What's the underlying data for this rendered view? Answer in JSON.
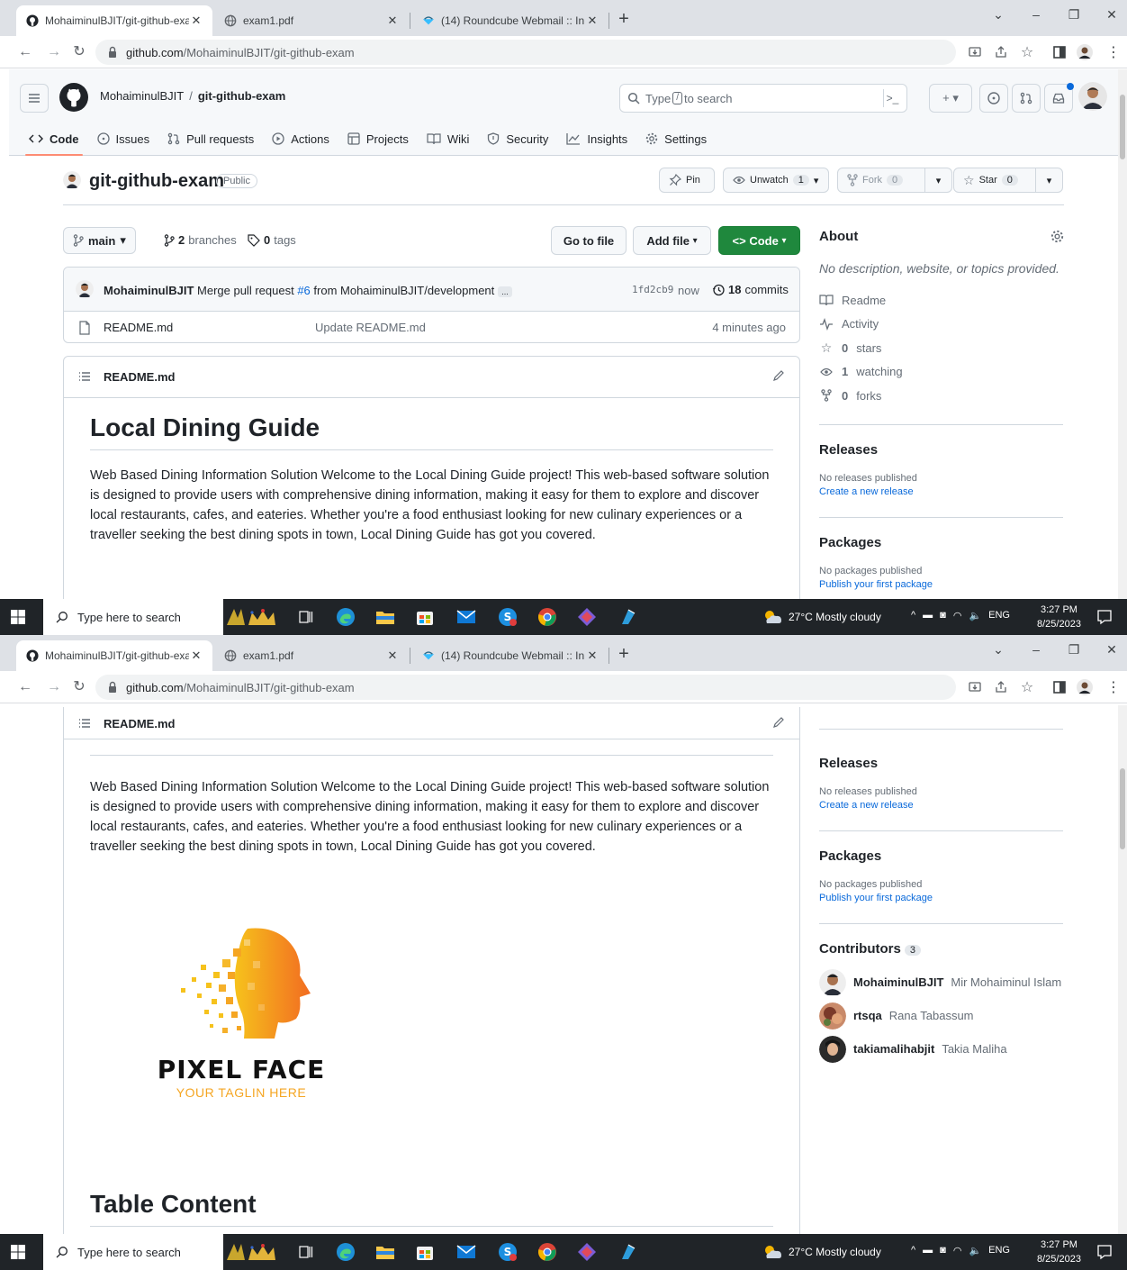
{
  "browser": {
    "tabs": [
      {
        "title": "MohaiminulBJIT/git-github-exam",
        "active": true
      },
      {
        "title": "exam1.pdf",
        "active": false
      },
      {
        "title": "(14) Roundcube Webmail :: Inbox",
        "active": false
      }
    ],
    "url_host": "github.com",
    "url_path": "/MohaiminulBJIT/git-github-exam"
  },
  "header": {
    "owner": "MohaiminulBJIT",
    "separator": "/",
    "repo": "git-github-exam",
    "search_prefix": "Type",
    "search_key": "/",
    "search_suffix": "to search"
  },
  "repo_nav": {
    "items": [
      "Code",
      "Issues",
      "Pull requests",
      "Actions",
      "Projects",
      "Wiki",
      "Security",
      "Insights",
      "Settings"
    ]
  },
  "title_row": {
    "name": "git-github-exam",
    "visibility": "Public",
    "pin": "Pin",
    "unwatch": "Unwatch",
    "unwatch_count": "1",
    "fork": "Fork",
    "fork_count": "0",
    "star": "Star",
    "star_count": "0"
  },
  "branch_row": {
    "branch": "main",
    "branches_count": "2",
    "branches_label": "branches",
    "tags_count": "0",
    "tags_label": "tags",
    "go_to_file": "Go to file",
    "add_file": "Add file",
    "code": "Code"
  },
  "commit": {
    "author": "MohaiminulBJIT",
    "message_pre": "Merge pull request",
    "pr": "#6",
    "message_post": "from MohaiminulBJIT/development",
    "ellipsis": "...",
    "sha": "1fd2cb9",
    "when": "now",
    "commits_count": "18",
    "commits_label": "commits"
  },
  "files": [
    {
      "name": "README.md",
      "message": "Update README.md",
      "age": "4 minutes ago"
    }
  ],
  "readme": {
    "filename": "README.md",
    "h1": "Local Dining Guide",
    "paragraph": "Web Based Dining Information Solution Welcome to the Local Dining Guide project! This web-based software solution is designed to provide users with comprehensive dining information, making it easy for them to explore and discover local restaurants, cafes, and eateries. Whether you're a food enthusiast looking for new culinary experiences or a traveller seeking the best dining spots in town, Local Dining Guide has got you covered.",
    "logo_text": "PIXEL FACE",
    "logo_tagline": "YOUR TAGLIN HERE",
    "h2": "Table Content"
  },
  "about": {
    "title": "About",
    "description": "No description, website, or topics provided.",
    "readme": "Readme",
    "activity": "Activity",
    "stars_count": "0",
    "stars_label": "stars",
    "watching_count": "1",
    "watching_label": "watching",
    "forks_count": "0",
    "forks_label": "forks"
  },
  "releases": {
    "title": "Releases",
    "none": "No releases published",
    "create": "Create a new release"
  },
  "packages": {
    "title": "Packages",
    "none": "No packages published",
    "publish": "Publish your first package"
  },
  "contributors": {
    "title": "Contributors",
    "count": "3",
    "list": [
      {
        "login": "MohaiminulBJIT",
        "name": "Mir Mohaiminul Islam"
      },
      {
        "login": "rtsqa",
        "name": "Rana Tabassum"
      },
      {
        "login": "takiamalihabjit",
        "name": "Takia Maliha"
      }
    ]
  },
  "taskbar": {
    "search": "Type here to search",
    "weather": "27°C  Mostly cloudy",
    "lang": "ENG",
    "time": "3:27 PM",
    "date": "8/25/2023"
  },
  "colors": {
    "accent_green": "#1f883d",
    "link": "#0969da",
    "tab_underline": "#fd8c73"
  }
}
